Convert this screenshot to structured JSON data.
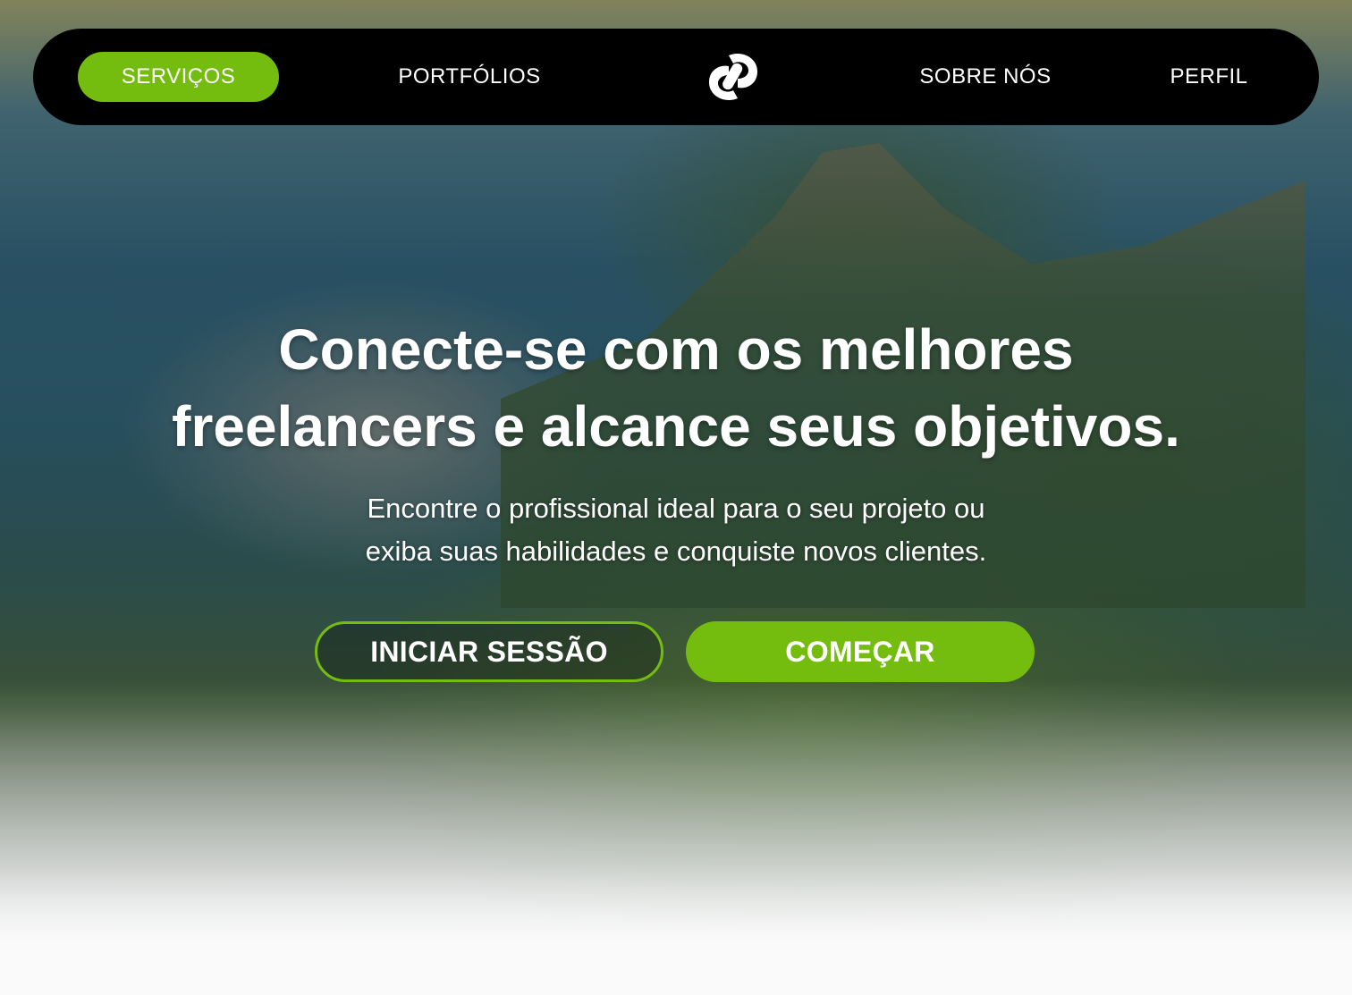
{
  "nav": {
    "items": [
      {
        "label": "SERVIÇOS",
        "active": true
      },
      {
        "label": "PORTFÓLIOS",
        "active": false
      },
      {
        "label": "SOBRE NÓS",
        "active": false
      },
      {
        "label": "PERFIL",
        "active": false
      }
    ],
    "logo_icon": "link-logo-icon"
  },
  "hero": {
    "headline_line1": "Conecte-se com os melhores",
    "headline_line2": "freelancers e alcance seus objetivos.",
    "subtitle_line1": "Encontre o profissional ideal para o seu projeto ou",
    "subtitle_line2": "exiba suas habilidades e conquiste novos clientes.",
    "login_label": "INICIAR SESSÃO",
    "start_label": "COMEÇAR",
    "background_description_icon": "landscape-background"
  },
  "colors": {
    "accent": "#74bd0e",
    "nav_background": "#000000",
    "text": "#ffffff"
  }
}
